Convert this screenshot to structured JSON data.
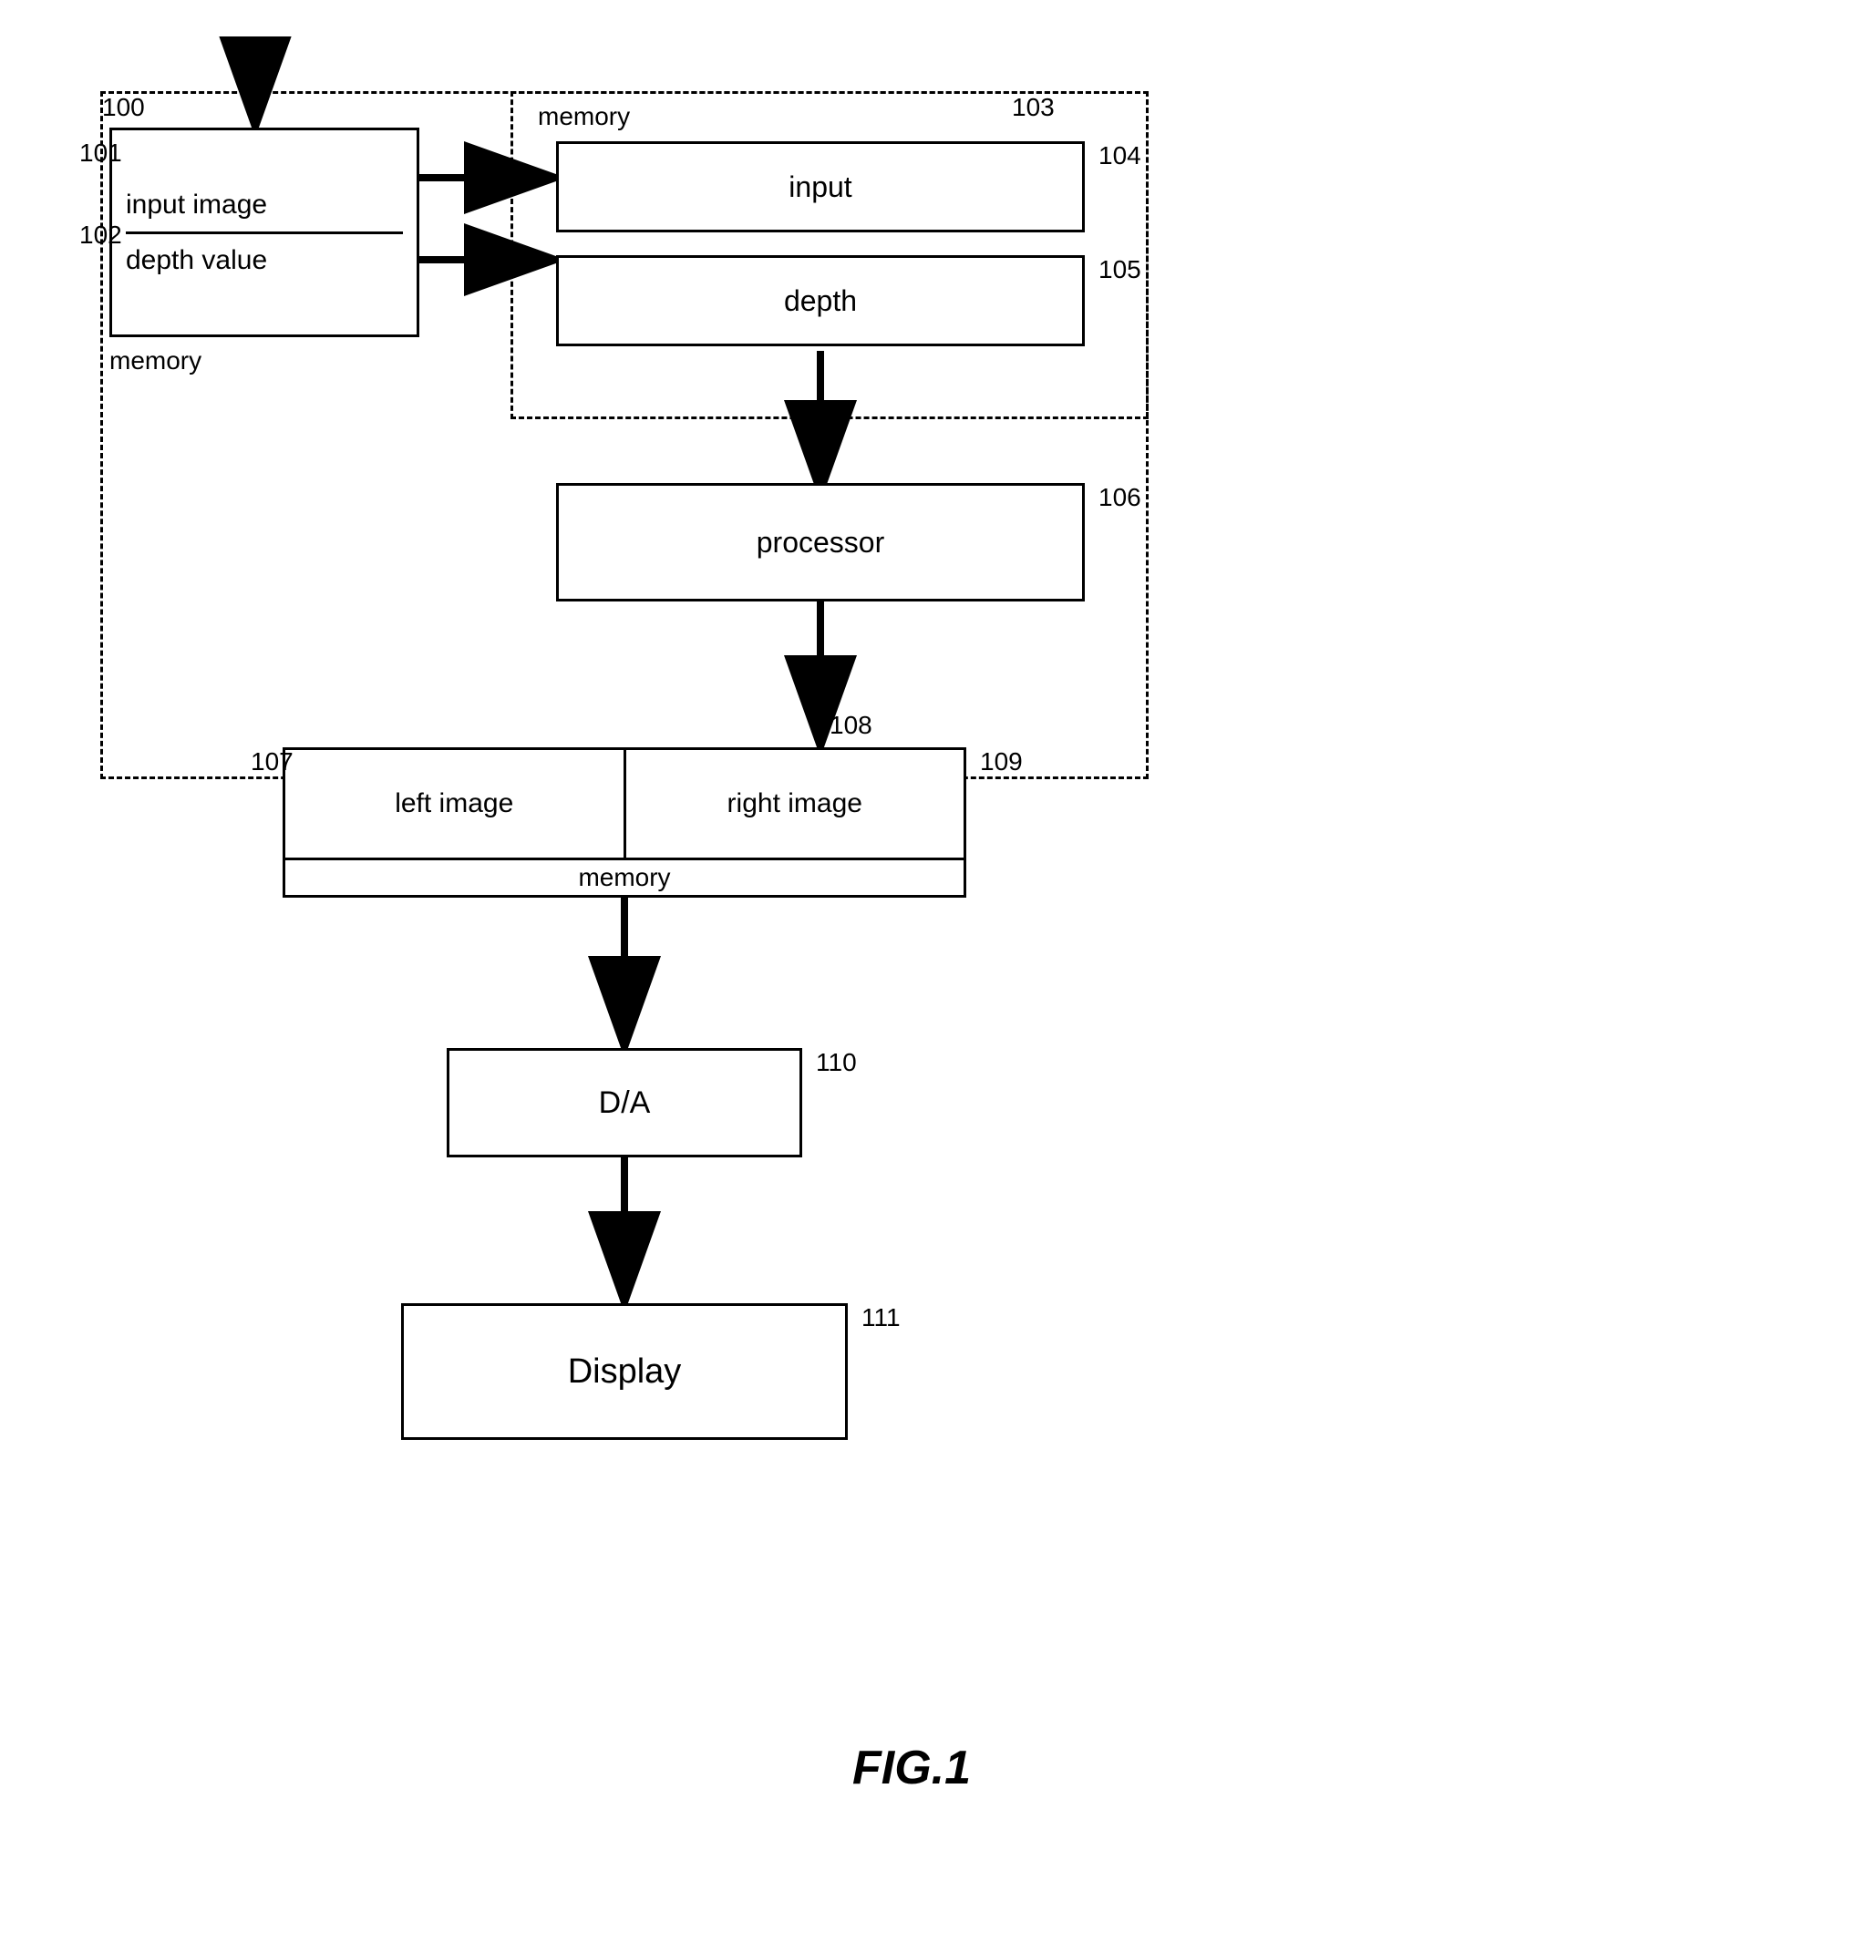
{
  "diagram": {
    "title": "FIG.1",
    "boxes": {
      "input_memory": {
        "line1": "input image",
        "line2": "depth value",
        "label_below": "memory"
      },
      "memory_outer": {
        "label": "memory"
      },
      "input_inner": {
        "label": "input"
      },
      "depth_inner": {
        "label": "depth"
      },
      "processor": {
        "label": "processor"
      },
      "image_memory": {
        "left_image": "left image",
        "right_image": "right image",
        "memory_label": "memory"
      },
      "da": {
        "label": "D/A"
      },
      "display": {
        "label": "Display"
      }
    },
    "refs": {
      "r100": "100",
      "r101": "101",
      "r102": "102",
      "r103": "103",
      "r104": "104",
      "r105": "105",
      "r106": "106",
      "r107": "107",
      "r108": "108",
      "r109": "109",
      "r110": "110",
      "r111": "111"
    }
  }
}
